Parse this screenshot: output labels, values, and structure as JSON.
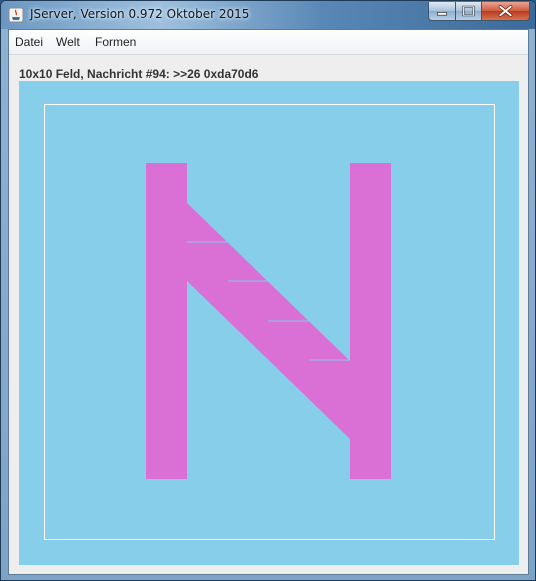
{
  "window": {
    "title": "JServer, Version 0.972 Oktober 2015",
    "icon": "java-icon"
  },
  "menu": {
    "items": [
      {
        "label": "Datei"
      },
      {
        "label": "Welt"
      },
      {
        "label": "Formen"
      }
    ]
  },
  "status": {
    "text": "10x10 Feld, Nachricht #94: >>26 0xda70d6"
  },
  "canvas": {
    "background": "#87ceeb",
    "shape_color": "#da70d6",
    "border_color": "#ffffff",
    "grid_size": "10x10"
  }
}
